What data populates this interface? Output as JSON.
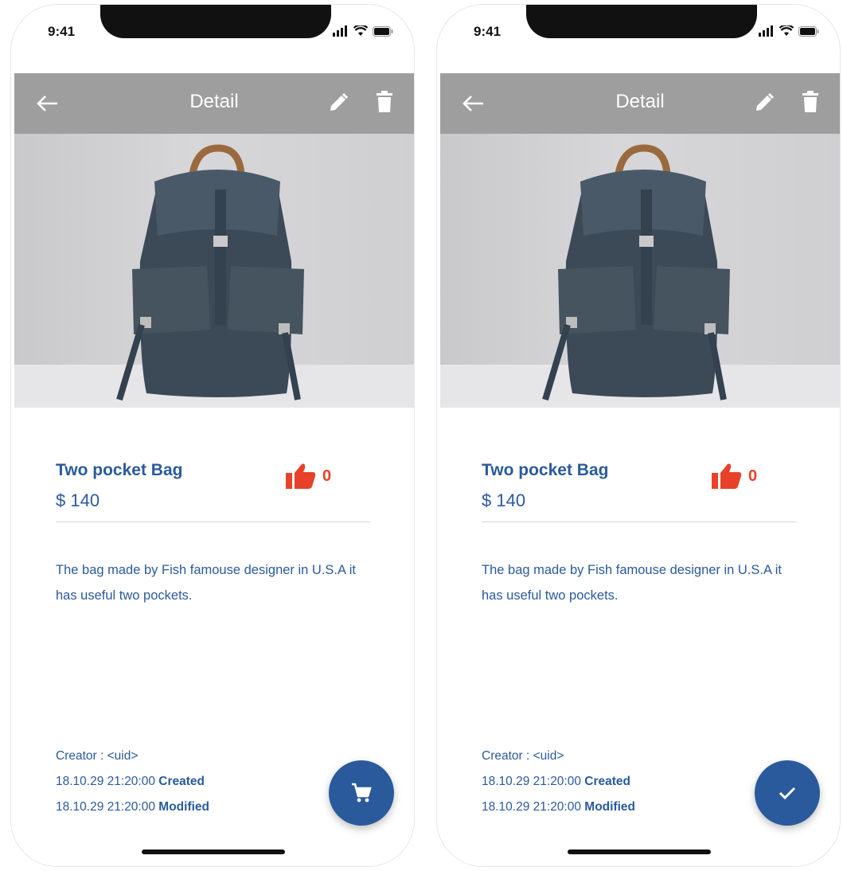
{
  "screens": [
    {
      "status": {
        "time": "9:41"
      },
      "app_bar": {
        "title": "Detail"
      },
      "product": {
        "name": "Two pocket Bag",
        "price": "$ 140",
        "likes": "0",
        "description": "The bag made by Fish famouse designer in U.S.A it has useful two pockets."
      },
      "meta": {
        "creator": "Creator : <uid>",
        "created_date": "18.10.29 21:20:00",
        "created_label": "Created",
        "modified_date": "18.10.29 21:20:00",
        "modified_label": "Modified"
      },
      "fab": {
        "icon": "cart-icon"
      }
    },
    {
      "status": {
        "time": "9:41"
      },
      "app_bar": {
        "title": "Detail"
      },
      "product": {
        "name": "Two pocket Bag",
        "price": "$ 140",
        "likes": "0",
        "description": "The bag made by Fish famouse designer in U.S.A it has useful two pockets."
      },
      "meta": {
        "creator": "Creator : <uid>",
        "created_date": "18.10.29 21:20:00",
        "created_label": "Created",
        "modified_date": "18.10.29 21:20:00",
        "modified_label": "Modified"
      },
      "fab": {
        "icon": "check-icon"
      }
    }
  ],
  "colors": {
    "primary": "#2a5a9c",
    "app_bar": "#9e9e9e",
    "like": "#e8412a"
  }
}
